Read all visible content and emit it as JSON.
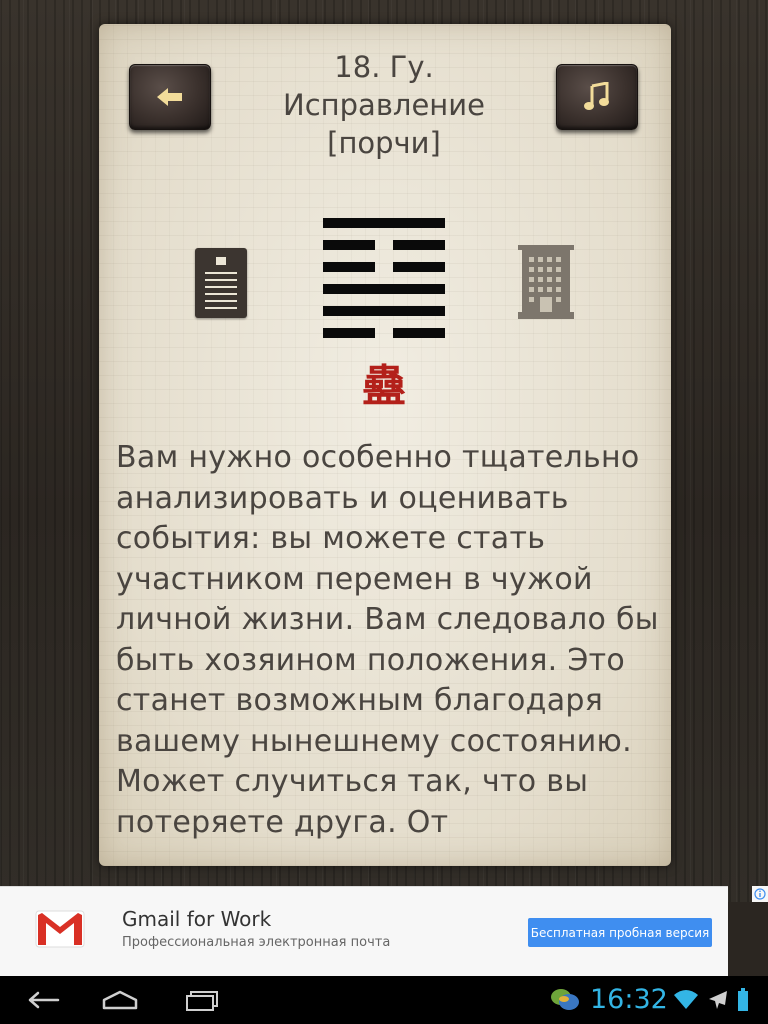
{
  "header": {
    "title_line1": "18. Гу.",
    "title_line2": "Исправление",
    "title_line3": "[порчи]",
    "back_icon": "arrow-left-icon",
    "music_icon": "music-note-icon"
  },
  "hexagram": {
    "lines": [
      "yang",
      "yin",
      "yin",
      "yang",
      "yang",
      "yin"
    ],
    "glyph": "蠱",
    "glyph_color": "#b3201a"
  },
  "side_icons": {
    "left": "document-icon",
    "right": "building-icon"
  },
  "reading": {
    "text": "Вам нужно особенно тщательно анализировать и оценивать события: вы можете стать участником перемен в чужой личной жизни. Вам следовало бы быть хозяином положения. Это станет возможным благодаря вашему нынешнему состоянию. Может случиться так, что вы потеряете друга. От"
  },
  "ad": {
    "logo_icon": "gmail-logo-icon",
    "title": "Gmail for Work",
    "subtitle": "Профессиональная электронная почта",
    "cta": "Бесплатная пробная версия",
    "cta_color": "#3f8ef0",
    "info_icon": "info-icon"
  },
  "system_bar": {
    "back_icon": "back-icon",
    "home_icon": "home-icon",
    "recents_icon": "recent-apps-icon",
    "notification_icon": "chat-bubbles-icon",
    "time": "16:32",
    "wifi_icon": "wifi-icon",
    "airplane_icon": "airplane-icon",
    "battery_icon": "battery-icon",
    "accent": "#33b5e5"
  }
}
